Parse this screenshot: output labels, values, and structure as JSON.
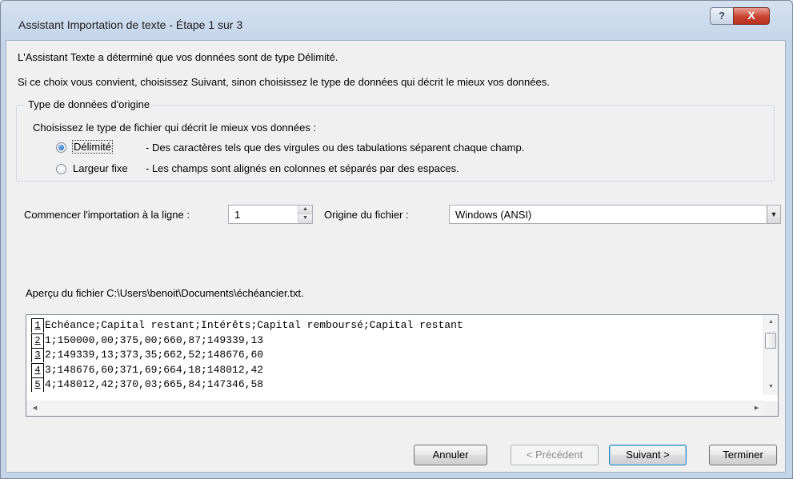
{
  "window": {
    "title": "Assistant Importation de texte - Étape 1 sur 3",
    "help_label": "?",
    "close_label": "X"
  },
  "intro": {
    "line1": "L'Assistant Texte a déterminé que vos données sont de type Délimité.",
    "line2": "Si ce choix vous convient, choisissez Suivant, sinon choisissez le type de données qui décrit le mieux vos données."
  },
  "data_type_group": {
    "legend": "Type de données d'origine",
    "instruction": "Choisissez le type de fichier qui décrit le mieux vos données :",
    "options": [
      {
        "label": "Délimité",
        "description": "- Des caractères tels que des virgules ou des tabulations séparent chaque champ.",
        "selected": true
      },
      {
        "label": "Largeur fixe",
        "description": "- Les champs sont alignés en colonnes et séparés par des espaces.",
        "selected": false
      }
    ]
  },
  "start_row": {
    "label": "Commencer l'importation à la ligne :",
    "value": "1"
  },
  "file_origin": {
    "label": "Origine du fichier :",
    "value": "Windows (ANSI)"
  },
  "preview": {
    "label": "Aperçu du fichier C:\\Users\\benoit\\Documents\\échéancier.txt.",
    "lines": [
      {
        "num": "1",
        "text": "Echéance;Capital restant;Intérêts;Capital remboursé;Capital restant"
      },
      {
        "num": "2",
        "text": " 1;150000,00;375,00;660,87;149339,13"
      },
      {
        "num": "3",
        "text": " 2;149339,13;373,35;662,52;148676,60"
      },
      {
        "num": "4",
        "text": " 3;148676,60;371,69;664,18;148012,42"
      },
      {
        "num": "5",
        "text": " 4;148012,42;370,03;665,84;147346,58"
      }
    ]
  },
  "buttons": {
    "cancel": "Annuler",
    "previous": "< Précédent",
    "next": "Suivant >",
    "finish": "Terminer"
  }
}
